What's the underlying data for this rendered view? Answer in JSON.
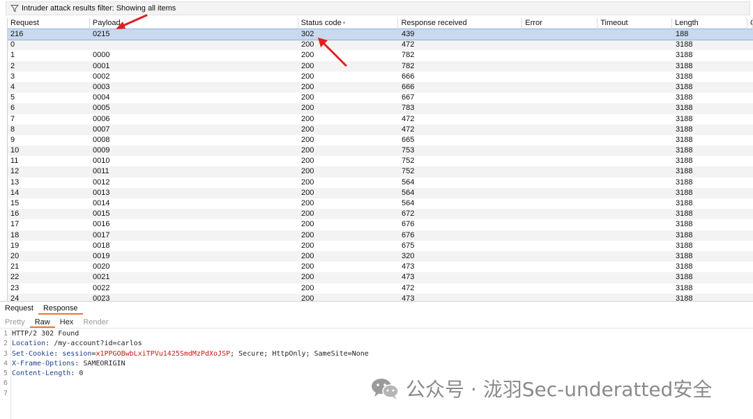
{
  "filter": {
    "text": "Intruder attack results filter: Showing all items"
  },
  "columns": [
    "Request",
    "Payload",
    "Status code",
    "Response received",
    "Error",
    "Timeout",
    "Length",
    "C"
  ],
  "rows": [
    [
      "216",
      "0215",
      "302",
      "439",
      "",
      "",
      "188"
    ],
    [
      "0",
      "",
      "200",
      "472",
      "",
      "",
      "3188"
    ],
    [
      "1",
      "0000",
      "200",
      "782",
      "",
      "",
      "3188"
    ],
    [
      "2",
      "0001",
      "200",
      "782",
      "",
      "",
      "3188"
    ],
    [
      "3",
      "0002",
      "200",
      "666",
      "",
      "",
      "3188"
    ],
    [
      "4",
      "0003",
      "200",
      "666",
      "",
      "",
      "3188"
    ],
    [
      "5",
      "0004",
      "200",
      "667",
      "",
      "",
      "3188"
    ],
    [
      "6",
      "0005",
      "200",
      "783",
      "",
      "",
      "3188"
    ],
    [
      "7",
      "0006",
      "200",
      "472",
      "",
      "",
      "3188"
    ],
    [
      "8",
      "0007",
      "200",
      "472",
      "",
      "",
      "3188"
    ],
    [
      "9",
      "0008",
      "200",
      "665",
      "",
      "",
      "3188"
    ],
    [
      "10",
      "0009",
      "200",
      "753",
      "",
      "",
      "3188"
    ],
    [
      "11",
      "0010",
      "200",
      "752",
      "",
      "",
      "3188"
    ],
    [
      "12",
      "0011",
      "200",
      "752",
      "",
      "",
      "3188"
    ],
    [
      "13",
      "0012",
      "200",
      "564",
      "",
      "",
      "3188"
    ],
    [
      "14",
      "0013",
      "200",
      "564",
      "",
      "",
      "3188"
    ],
    [
      "15",
      "0014",
      "200",
      "564",
      "",
      "",
      "3188"
    ],
    [
      "16",
      "0015",
      "200",
      "672",
      "",
      "",
      "3188"
    ],
    [
      "17",
      "0016",
      "200",
      "676",
      "",
      "",
      "3188"
    ],
    [
      "18",
      "0017",
      "200",
      "676",
      "",
      "",
      "3188"
    ],
    [
      "19",
      "0018",
      "200",
      "675",
      "",
      "",
      "3188"
    ],
    [
      "20",
      "0019",
      "200",
      "320",
      "",
      "",
      "3188"
    ],
    [
      "21",
      "0020",
      "200",
      "473",
      "",
      "",
      "3188"
    ],
    [
      "22",
      "0021",
      "200",
      "473",
      "",
      "",
      "3188"
    ],
    [
      "23",
      "0022",
      "200",
      "472",
      "",
      "",
      "3188"
    ],
    [
      "24",
      "0023",
      "200",
      "473",
      "",
      "",
      "3188"
    ]
  ],
  "tabs": {
    "request": "Request",
    "response": "Response"
  },
  "subtabs": {
    "pretty": "Pretty",
    "raw": "Raw",
    "hex": "Hex",
    "render": "Render"
  },
  "response": {
    "line_numbers": [
      "1",
      "2",
      "3",
      "4",
      "5",
      "6",
      "7"
    ],
    "l1": "HTTP/2 302 Found",
    "l2_key": "Location",
    "l2_val": ": /my-account?id=carlos",
    "l3_key": "Set-Cookie",
    "l3_colon": ": ",
    "l3_name": "session",
    "l3_eq": "=",
    "l3_value": "x1PPGOBwbLxiTPVu1425SmdMzPdXoJSP",
    "l3_rest": "; Secure; HttpOnly; SameSite=None",
    "l4_key": "X-Frame-Options",
    "l4_val": ": SAMEORIGIN",
    "l5_key": "Content-Length",
    "l5_val": ": 0"
  },
  "watermark": {
    "text": "公众号 · 泷羽Sec-underatted安全"
  },
  "colors": {
    "selected_row": "#c9d9ee",
    "tab_underline": "#e8762d",
    "annotation_arrow": "#e02020"
  }
}
